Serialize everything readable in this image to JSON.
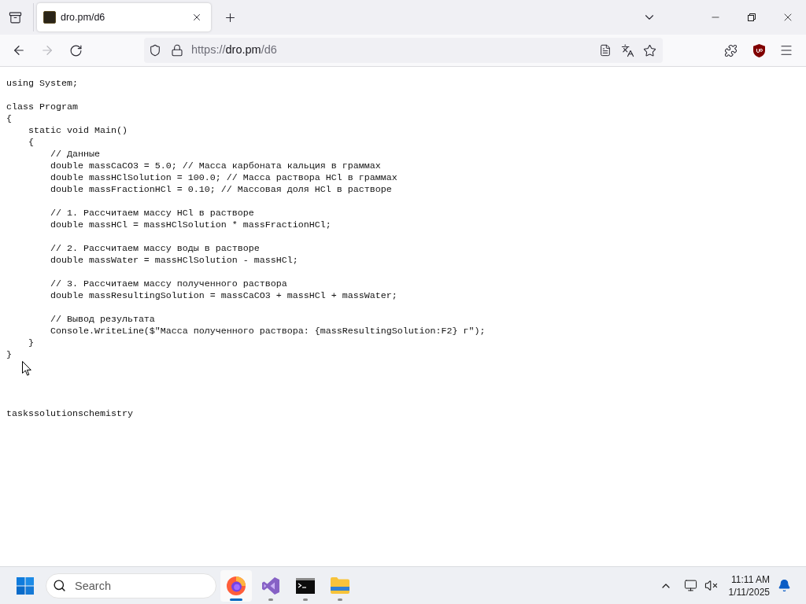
{
  "browser": {
    "tabs": [
      {
        "title": "dro.pm/d6",
        "selected": true
      }
    ],
    "navigation": {
      "back": {
        "disabled": false
      },
      "forward": {
        "disabled": true
      }
    },
    "address": {
      "scheme": "https://",
      "host": "dro.pm",
      "path": "/d6"
    }
  },
  "page": {
    "code": "using System;\n\nclass Program\n{\n    static void Main()\n    {\n        // Данные\n        double massCaCO3 = 5.0; // Масса карбоната кальция в граммах\n        double massHClSolution = 100.0; // Масса раствора HCl в граммах\n        double massFractionHCl = 0.10; // Массовая доля HCl в растворе\n\n        // 1. Рассчитаем массу HCl в растворе\n        double massHCl = massHClSolution * massFractionHCl;\n\n        // 2. Рассчитаем массу воды в растворе\n        double massWater = massHClSolution - massHCl;\n\n        // 3. Рассчитаем массу полученного раствора\n        double massResultingSolution = massCaCO3 + massHCl + massWater;\n\n        // Вывод результата\n        Console.WriteLine($\"Масса полученного раствора: {massResultingSolution:F2} г\");\n    }\n}",
    "footer": "taskssolutionschemistry"
  },
  "taskbar": {
    "search": {
      "placeholder": "Search"
    },
    "apps": [
      {
        "kind": "browser",
        "selected": true
      },
      {
        "kind": "ide",
        "selected": false
      },
      {
        "kind": "terminal",
        "selected": false
      },
      {
        "kind": "files",
        "selected": false
      }
    ],
    "clock": {
      "time": "11:11 AM",
      "date": "1/11/2025"
    }
  }
}
